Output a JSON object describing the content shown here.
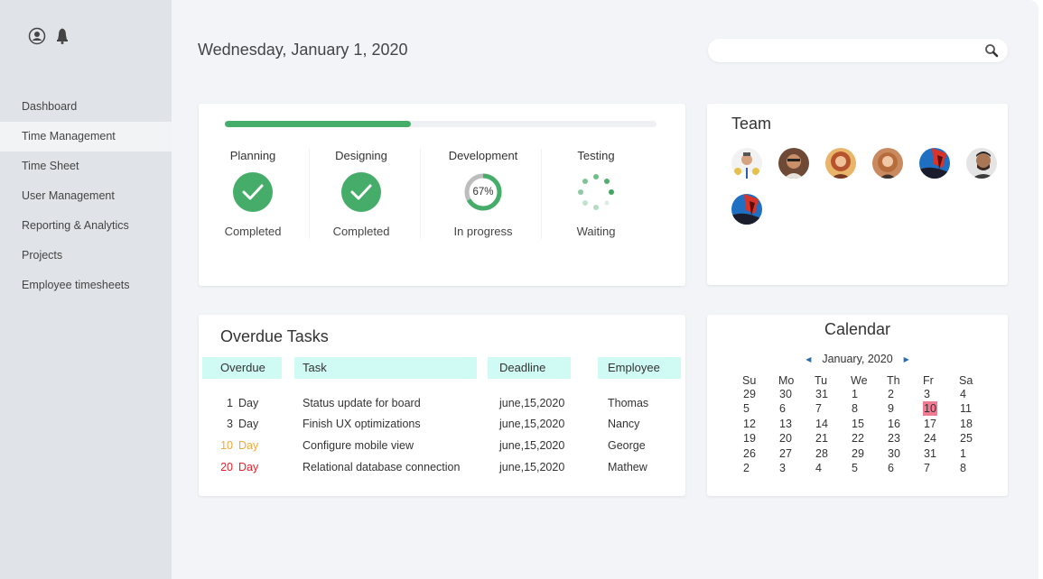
{
  "header": {
    "date": "Wednesday, January 1, 2020",
    "search_placeholder": "",
    "search_value": ""
  },
  "sidebar": {
    "icons": [
      "user-icon",
      "bell-icon"
    ],
    "items": [
      {
        "label": "Dashboard",
        "active": false
      },
      {
        "label": "Time Management",
        "active": true
      },
      {
        "label": "Time Sheet",
        "active": false
      },
      {
        "label": "User Management",
        "active": false
      },
      {
        "label": "Reporting & Analytics",
        "active": false
      },
      {
        "label": "Projects",
        "active": false
      },
      {
        "label": "Employee timesheets",
        "active": false
      }
    ]
  },
  "progress": {
    "overall_fraction": 0.43,
    "accent_color": "#45ad69",
    "stages": [
      {
        "title": "Planning",
        "status": "Completed",
        "icon": "check-circle-icon"
      },
      {
        "title": "Designing",
        "status": "Completed",
        "icon": "check-circle-icon"
      },
      {
        "title": "Development",
        "status": "In progress",
        "icon": "progress-ring-icon",
        "percent_label": "67%",
        "percent": 67
      },
      {
        "title": "Testing",
        "status": "Waiting",
        "icon": "spinner-icon"
      }
    ]
  },
  "team": {
    "title": "Team",
    "members": [
      "member-1",
      "member-2",
      "member-3",
      "member-4",
      "member-5",
      "member-6",
      "member-7"
    ]
  },
  "overdue": {
    "title": "Overdue Tasks",
    "columns": [
      "Overdue",
      "Task",
      "Deadline",
      "Employee"
    ],
    "header_color": "#d0faf4",
    "rows": [
      {
        "days": "1",
        "unit": "Day",
        "task": "Status update for board",
        "deadline": "june,15,2020",
        "employee": "Thomas",
        "color": "#333333"
      },
      {
        "days": "3",
        "unit": "Day",
        "task": "Finish UX optimizations",
        "deadline": "june,15,2020",
        "employee": "Nancy",
        "color": "#333333"
      },
      {
        "days": "10",
        "unit": "Day",
        "task": "Configure mobile view",
        "deadline": "june,15,2020",
        "employee": "George",
        "color": "#f0a93a"
      },
      {
        "days": "20",
        "unit": "Day",
        "task": "Relational database connection",
        "deadline": "june,15,2020",
        "employee": "Mathew",
        "color": "#e8202a"
      }
    ]
  },
  "calendar": {
    "title": "Calendar",
    "month_label": "January, 2020",
    "weekdays": [
      "Su",
      "Mo",
      "Tu",
      "We",
      "Th",
      "Fr",
      "Sa"
    ],
    "weeks": [
      [
        "29",
        "30",
        "31",
        "1",
        "2",
        "3",
        "4"
      ],
      [
        "5",
        "6",
        "7",
        "8",
        "9",
        "10",
        "11"
      ],
      [
        "12",
        "13",
        "14",
        "15",
        "16",
        "17",
        "18"
      ],
      [
        "19",
        "20",
        "21",
        "22",
        "23",
        "24",
        "25"
      ],
      [
        "26",
        "27",
        "28",
        "29",
        "30",
        "31",
        "1"
      ],
      [
        "2",
        "3",
        "4",
        "5",
        "6",
        "7",
        "8"
      ]
    ],
    "selected": "10",
    "selected_color": "#f07c94"
  }
}
